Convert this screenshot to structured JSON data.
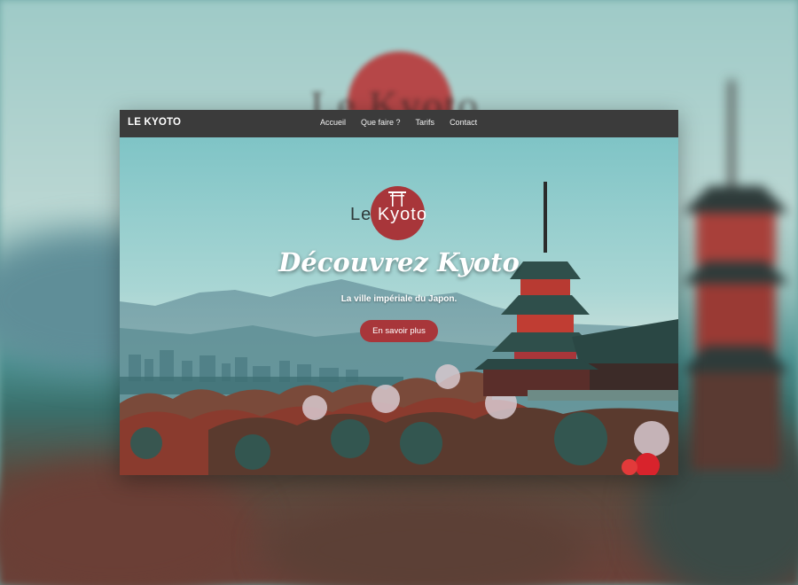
{
  "navbar": {
    "brand": "LE KYOTO",
    "links": [
      "Accueil",
      "Que faire ?",
      "Tarifs",
      "Contact"
    ]
  },
  "hero": {
    "logo_prefix": "Le ",
    "logo_name": "Kyoto",
    "title": "Découvrez Kyoto",
    "subtitle": "La ville impériale du Japon.",
    "cta_label": "En savoir plus"
  },
  "backdrop": {
    "logo_text": "Le Kyoto"
  },
  "colors": {
    "navbar_bg": "#3b3b3b",
    "accent_red": "#a8363a",
    "text_white": "#ffffff"
  },
  "icons": [
    "torii-gate-icon"
  ]
}
